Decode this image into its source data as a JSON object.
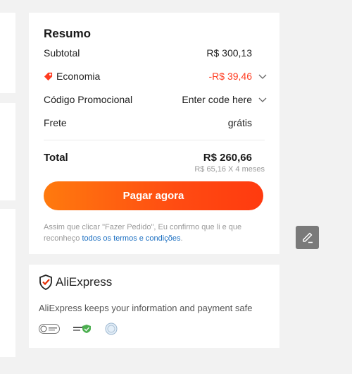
{
  "summary": {
    "title": "Resumo",
    "subtotal_label": "Subtotal",
    "subtotal_value": "R$ 300,13",
    "economia_label": "Economia",
    "economia_value": "-R$ 39,46",
    "promo_label": "Código Promocional",
    "promo_value": "Enter code here",
    "frete_label": "Frete",
    "frete_value": "grátis",
    "total_label": "Total",
    "total_value": "R$ 260,66",
    "installments": "R$ 65,16 X 4 meses",
    "pay_button": "Pagar agora",
    "legal_text": "Assim que clicar \"Fazer Pedido\", Eu confirmo que li e que reconheço ",
    "legal_link": "todos os termos e condições",
    "legal_end": "."
  },
  "trust": {
    "brand": "AliExpress",
    "text": "AliExpress keeps your information and payment safe"
  },
  "colors": {
    "accent": "#ff4c12",
    "discount": "#ff3b20",
    "link": "#1a6ec1"
  }
}
